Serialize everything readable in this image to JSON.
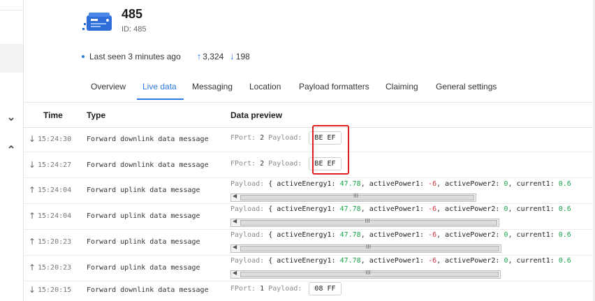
{
  "device": {
    "name": "485",
    "id_label": "ID: 485",
    "status_text": "Last seen 3 minutes ago",
    "uplink_count": "3,324",
    "downlink_count": "198",
    "up_arrow": "↑",
    "down_arrow": "↓",
    "icon": "device-board-icon"
  },
  "tabs": [
    {
      "label": "Overview"
    },
    {
      "label": "Live data"
    },
    {
      "label": "Messaging"
    },
    {
      "label": "Location"
    },
    {
      "label": "Payload formatters"
    },
    {
      "label": "Claiming"
    },
    {
      "label": "General settings"
    }
  ],
  "active_tab": "Live data",
  "table": {
    "headers": {
      "time": "Time",
      "type": "Type",
      "preview": "Data preview"
    },
    "fport_label": "FPort:",
    "payload_label": "Payload:",
    "rows": [
      {
        "direction": "down",
        "arrow": "↓",
        "time": "15:24:30",
        "type": "Forward downlink data message",
        "fport": "2",
        "payload": "BE EF"
      },
      {
        "direction": "down",
        "arrow": "↓",
        "time": "15:24:27",
        "type": "Forward downlink data message",
        "fport": "2",
        "payload": "BE EF"
      },
      {
        "direction": "up",
        "arrow": "↑",
        "time": "15:24:04",
        "type": "Forward uplink data message"
      },
      {
        "direction": "up",
        "arrow": "↑",
        "time": "15:24:04",
        "type": "Forward uplink data message"
      },
      {
        "direction": "up",
        "arrow": "↑",
        "time": "15:20:23",
        "type": "Forward uplink data message"
      },
      {
        "direction": "up",
        "arrow": "↑",
        "time": "15:20:23",
        "type": "Forward uplink data message"
      },
      {
        "direction": "down",
        "arrow": "↓",
        "time": "15:20:15",
        "type": "Forward downlink data message",
        "fport": "1",
        "payload": "08 FF"
      }
    ],
    "uplink_payload": {
      "prefix": "Payload:",
      "brace": "{",
      "k1": "activeEnergy1:",
      "v1": "47.78",
      "k2": "activePower1:",
      "v2": "-6",
      "k3": "activePower2:",
      "v3": "0",
      "k4": "current1:",
      "v4": "0.6"
    }
  },
  "colors": {
    "accent": "#2d7be0",
    "highlight_box": "#e02020",
    "positive_value": "#19a64a",
    "negative_value": "#d2303d"
  }
}
